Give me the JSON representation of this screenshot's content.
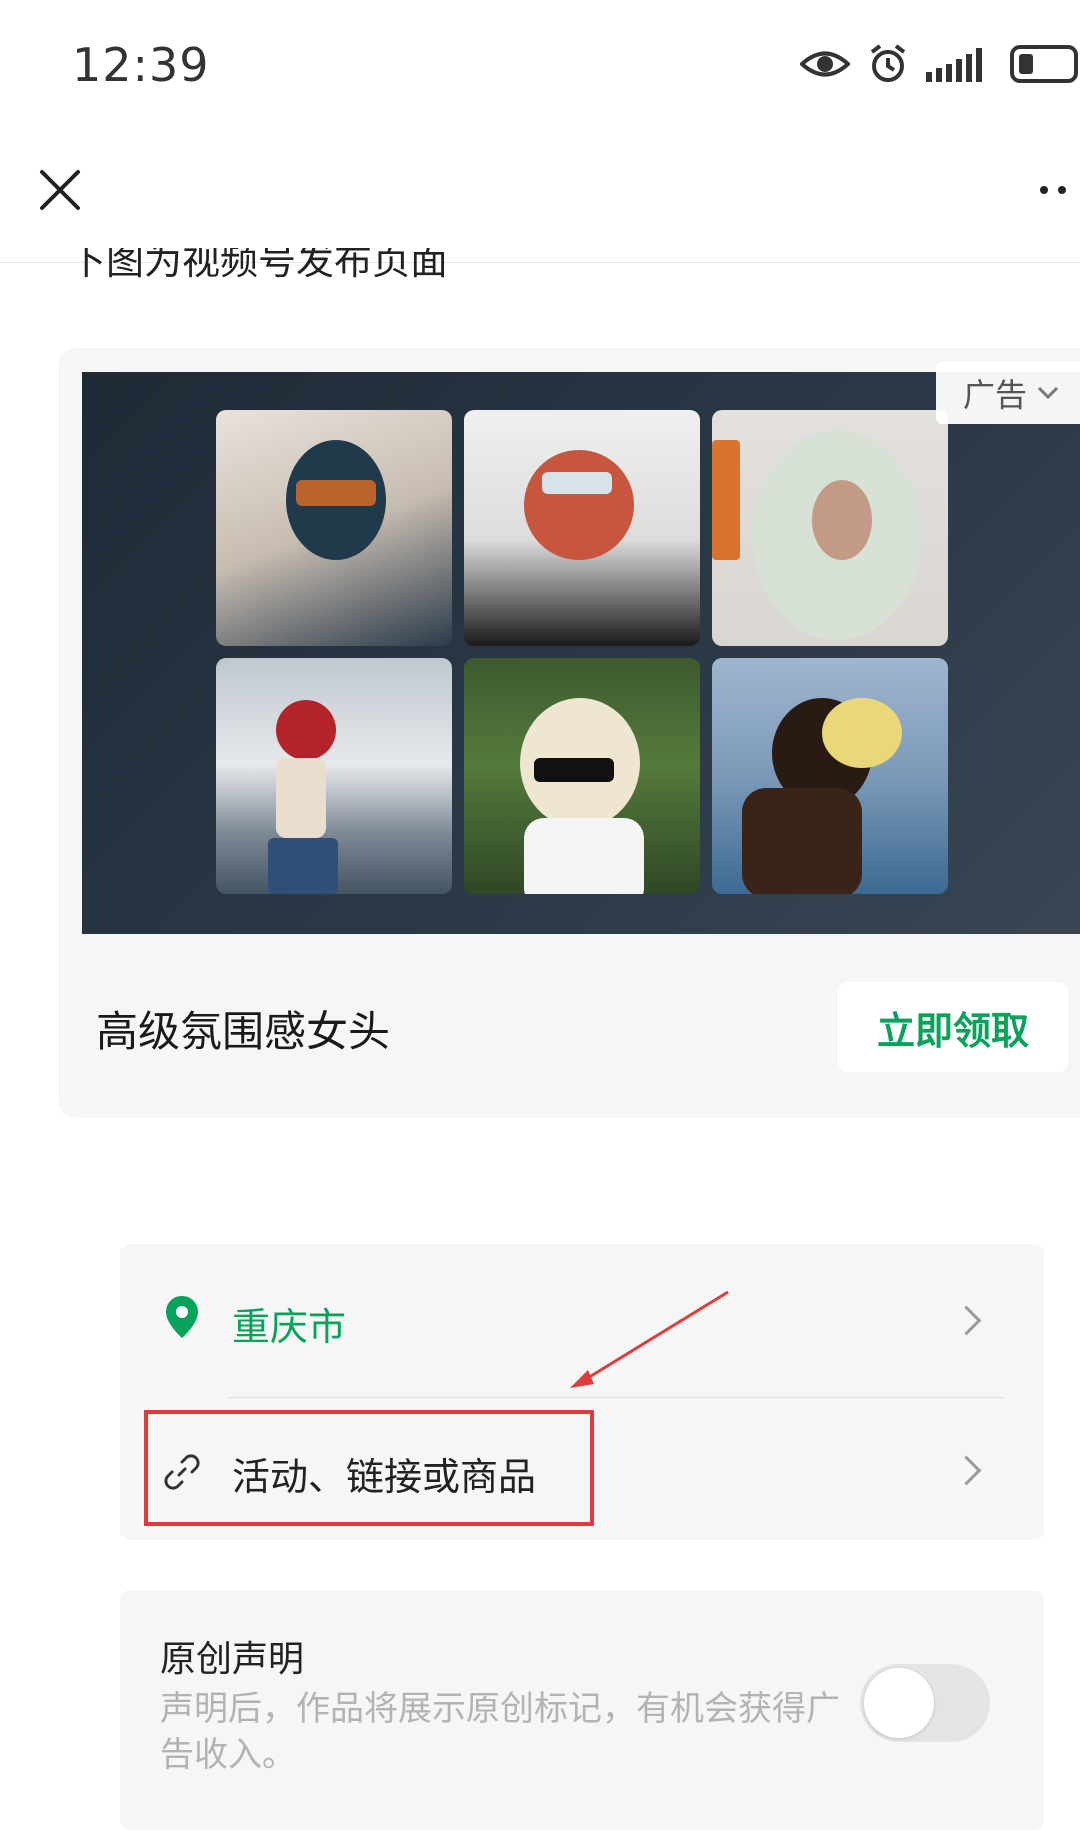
{
  "status_bar": {
    "time": "12:39",
    "icons": [
      "eye-icon",
      "alarm-icon",
      "signal-icon",
      "battery-icon"
    ]
  },
  "nav": {
    "close_icon": "close-icon",
    "more_icon": "more-icon"
  },
  "content": {
    "clipped_heading": "下图为视频号发布页面"
  },
  "ad": {
    "badge_label": "广告",
    "title": "高级氛围感女头",
    "cta_label": "立即领取",
    "cta_color": "#07a35a"
  },
  "options": {
    "location_label": "重庆市",
    "location_color": "#07a35a",
    "link_label": "活动、链接或商品"
  },
  "annotation": {
    "color": "#e23b3b"
  },
  "original": {
    "title": "原创声明",
    "description": "声明后，作品将展示原创标记，有机会获得广告收入。",
    "toggle_on": false
  }
}
